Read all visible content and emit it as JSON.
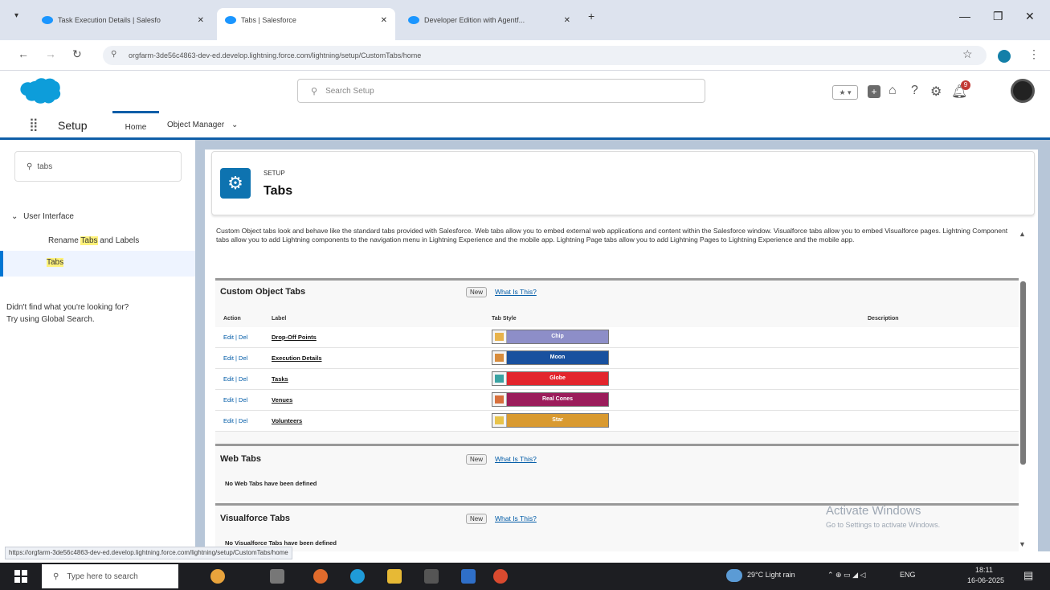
{
  "browser": {
    "tabs": [
      {
        "label": "Task Execution Details | Salesfo"
      },
      {
        "label": "Tabs | Salesforce"
      },
      {
        "label": "Developer Edition with Agentf..."
      }
    ],
    "new_tab": "+",
    "url": "orgfarm-3de56c4863-dev-ed.develop.lightning.force.com/lightning/setup/CustomTabs/home"
  },
  "header": {
    "search_placeholder": "Search Setup",
    "notification_count": "9"
  },
  "nav": {
    "app_title": "Setup",
    "home_tab": "Home",
    "object_manager_tab": "Object Manager"
  },
  "sidebar": {
    "quick_find_value": "tabs",
    "group_label": "User Interface",
    "item1_pre": "Rename ",
    "item1_hl": "Tabs",
    "item1_post": " and Labels",
    "item2": "Tabs",
    "help1": "Didn't find what you're looking for?",
    "help2": "Try using Global Search."
  },
  "page": {
    "kicker": "SETUP",
    "title": "Tabs",
    "description": "Custom Object tabs look and behave like the standard tabs provided with Salesforce. Web tabs allow you to embed external web applications and content within the Salesforce window. Visualforce tabs allow you to embed Visualforce pages. Lightning Component tabs allow you to add Lightning components to the navigation menu in Lightning Experience and the mobile app. Lightning Page tabs allow you to add Lightning Pages to Lightning Experience and the mobile app."
  },
  "custom_object_tabs": {
    "title": "Custom Object Tabs",
    "new_button": "New",
    "what_link": "What Is This?",
    "col_action": "Action",
    "col_label": "Label",
    "col_style": "Tab Style",
    "col_description": "Description",
    "rows": [
      {
        "action": "Edit | Del",
        "label": "Drop-Off Points",
        "style": "Chip",
        "color": "#8d8ec8",
        "icon": "#e8b34b"
      },
      {
        "action": "Edit | Del",
        "label": "Execution Details",
        "style": "Moon",
        "color": "#19519f",
        "icon": "#d88c3c"
      },
      {
        "action": "Edit | Del",
        "label": "Tasks",
        "style": "Globe",
        "color": "#e3252c",
        "icon": "#3aa3a3"
      },
      {
        "action": "Edit | Del",
        "label": "Venues",
        "style": "Real Cones",
        "color": "#9b1d5b",
        "icon": "#d8703c"
      },
      {
        "action": "Edit | Del",
        "label": "Volunteers",
        "style": "Star",
        "color": "#d99a30",
        "icon": "#e8c34b"
      }
    ]
  },
  "web_tabs": {
    "title": "Web Tabs",
    "new_button": "New",
    "what_link": "What Is This?",
    "empty": "No Web Tabs have been defined"
  },
  "visualforce_tabs": {
    "title": "Visualforce Tabs",
    "new_button": "New",
    "what_link": "What Is This?",
    "empty": "No Visualforce Tabs have been defined"
  },
  "watermark": {
    "line1": "Activate Windows",
    "line2": "Go to Settings to activate Windows."
  },
  "status_url": "https://orgfarm-3de56c4863-dev-ed.develop.lightning.force.com/lightning/setup/CustomTabs/home",
  "taskbar": {
    "search_placeholder": "Type here to search",
    "weather": "29°C  Light rain",
    "lang": "ENG",
    "time": "18:11",
    "date": "16-06-2025"
  }
}
